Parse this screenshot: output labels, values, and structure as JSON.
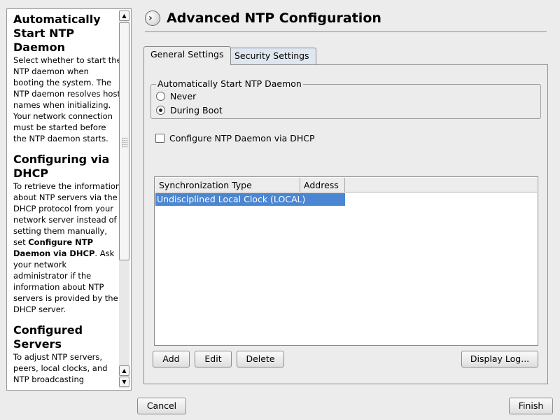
{
  "help": {
    "sections": [
      {
        "title": "Automatically Start NTP Daemon",
        "body": "Select whether to start the NTP daemon when booting the system. The NTP daemon resolves host names when initializing. Your network connection must be started before the NTP daemon starts."
      },
      {
        "title": "Configuring via DHCP",
        "body_pre": "To retrieve the information about NTP servers via the DHCP protocol from your network server instead of setting them manually, set ",
        "body_bold": "Configure NTP Daemon via DHCP",
        "body_post": ". Ask your network administrator if the information about NTP servers is provided by the DHCP server."
      },
      {
        "title": "Configured Servers",
        "body": "To adjust NTP servers, peers, local clocks, and NTP broadcasting"
      }
    ],
    "scroll_up": "▲",
    "scroll_down": "▼",
    "scroll_up_lower": "▲"
  },
  "page_title": "Advanced NTP Configuration",
  "title_icon": "yast-ntp-clock-icon",
  "tabs": [
    {
      "label": "General Settings",
      "selected": true
    },
    {
      "label": "Security Settings",
      "selected": false
    }
  ],
  "autostart": {
    "legend": "Automatically Start NTP Daemon",
    "options": [
      {
        "label": "Never",
        "selected": false
      },
      {
        "label": "During Boot",
        "selected": true
      }
    ]
  },
  "dhcp": {
    "label": "Configure NTP Daemon via DHCP",
    "checked": false
  },
  "table": {
    "columns": [
      "Synchronization Type",
      "Address"
    ],
    "rows": [
      {
        "sync_type": "Undisciplined Local Clock (LOCAL)",
        "address": "",
        "selected": true
      }
    ]
  },
  "buttons": {
    "add": "Add",
    "edit": "Edit",
    "delete": "Delete",
    "display_log": "Display Log...",
    "cancel": "Cancel",
    "finish": "Finish"
  },
  "colors": {
    "selection": "#4a86d1",
    "background": "#ececec"
  }
}
